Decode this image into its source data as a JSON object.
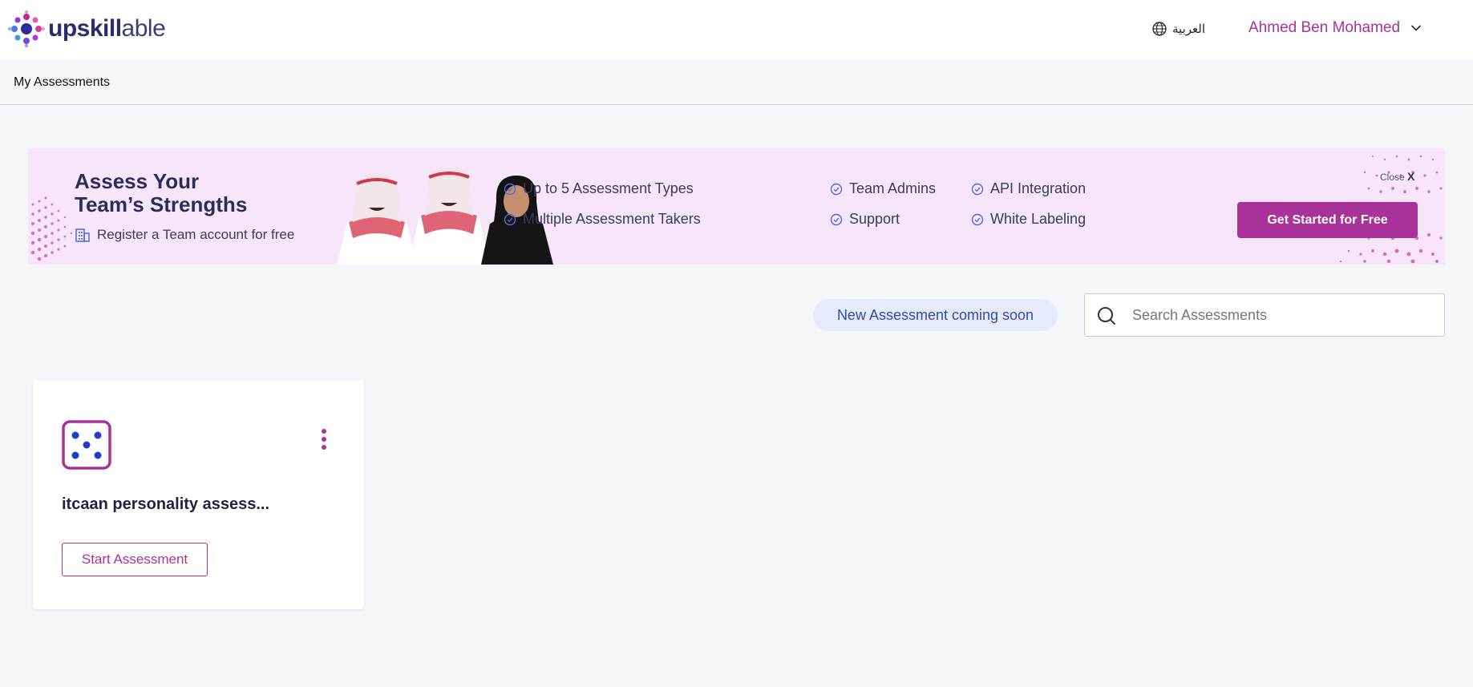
{
  "header": {
    "logo": {
      "bold": "upskill",
      "light": "able"
    },
    "language": "العربية",
    "user_name": "Ahmed Ben Mohamed"
  },
  "breadcrumb": {
    "current": "My Assessments"
  },
  "banner": {
    "title_line1": "Assess Your",
    "title_line2": "Team’s Strengths",
    "subtitle": "Register a Team account for free",
    "features": [
      "Up to 5 Assessment Types",
      "Multiple Assessment Takers",
      "Team Admins",
      "Support",
      "API Integration",
      "White Labeling"
    ],
    "close_label": "Close",
    "close_x": "X",
    "cta_label": "Get Started for Free"
  },
  "toolbar": {
    "coming_soon": "New Assessment coming soon",
    "search_placeholder": "Search Assessments"
  },
  "assessments": [
    {
      "title": "itcaan personality assess...",
      "action_label": "Start Assessment"
    }
  ],
  "colors": {
    "brand": "#a8329a",
    "navy": "#2b2d6b",
    "banner_bg": "#f7e6fa",
    "chip_bg": "#e6eafa",
    "chip_text": "#2d4da8",
    "dot_blue": "#1f3fc8"
  }
}
